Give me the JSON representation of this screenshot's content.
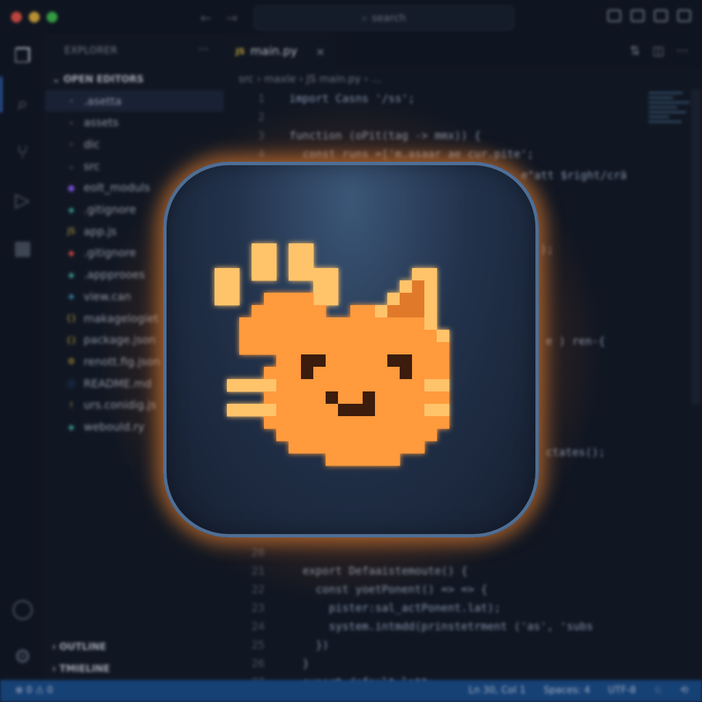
{
  "window": {
    "search_label": "search"
  },
  "activity_bar": {
    "items": [
      "files-icon",
      "search-icon",
      "source-control-icon",
      "run-debug-icon",
      "extensions-icon"
    ],
    "bottom": [
      "account-icon",
      "settings-gear-icon"
    ]
  },
  "explorer": {
    "title": "EXPLORER",
    "more": "···",
    "open_editors_label": "OPEN EDITORS",
    "files": [
      {
        "name": ".asetta",
        "icon": "›",
        "color": "#8a94a6"
      },
      {
        "name": "assets",
        "icon": "›",
        "color": "#8a94a6"
      },
      {
        "name": "dic",
        "icon": "›",
        "color": "#8a94a6"
      },
      {
        "name": "src",
        "icon": "⌄",
        "color": "#8a94a6"
      },
      {
        "name": "eolt_moduls",
        "icon": "●",
        "color": "#8b5cf6"
      },
      {
        "name": ".gitignore",
        "icon": "◆",
        "color": "#3fa7a0"
      },
      {
        "name": "app.js",
        "icon": "JS",
        "color": "#e8c547"
      },
      {
        "name": ".gitignore",
        "icon": "◆",
        "color": "#e5534b"
      },
      {
        "name": ".appprooes",
        "icon": "◆",
        "color": "#3fa7a0"
      },
      {
        "name": "view.can",
        "icon": "◆",
        "color": "#3b82a6"
      },
      {
        "name": "makagelogiet",
        "icon": "{}",
        "color": "#e8c547"
      },
      {
        "name": "package.json",
        "icon": "{}",
        "color": "#e8c547"
      },
      {
        "name": "renott.fig.json",
        "icon": "⚙",
        "color": "#e8c547"
      },
      {
        "name": "README.md",
        "icon": "ⓘ",
        "color": "#3b82f6"
      },
      {
        "name": "urs.conidig.js",
        "icon": "!",
        "color": "#e8c547"
      },
      {
        "name": "webould.ry",
        "icon": "◆",
        "color": "#3fa7a0"
      }
    ],
    "outline_label": "OUTLINE",
    "timeline_label": "TMIELINE"
  },
  "editor": {
    "tab_icon": "JS",
    "tab_label": "main.py",
    "tab_close": "×",
    "breadcrumb": "src › maxle › JS main.py › ...",
    "code_top": [
      {
        "ln": "1",
        "text": "import Casns '/ss';"
      },
      {
        "ln": "2",
        "text": ""
      },
      {
        "ln": "3",
        "text": "function (oPit(tag -> mmx)) {"
      },
      {
        "ln": "4",
        "text": "  const runs =['m.asaar ae cur.pite';"
      }
    ],
    "code_fragments": [
      {
        "text": "e\"att $right/crä"
      },
      {
        "text": ");"
      },
      {
        "text": "e ) ren-{"
      },
      {
        "text": "ctates();"
      }
    ],
    "code_bottom": [
      {
        "ln": "20",
        "text": ""
      },
      {
        "ln": "21",
        "text": "  export Defaaistemoute() {"
      },
      {
        "ln": "22",
        "text": "    const yoetPonent() => => {"
      },
      {
        "ln": "23",
        "text": "      pister:sal_actPonent.lat);"
      },
      {
        "ln": "24",
        "text": "      system.intmdd(prinstetrment ('as', 'subs"
      },
      {
        "ln": "25",
        "text": "    })"
      },
      {
        "ln": "26",
        "text": "  }"
      },
      {
        "ln": "27",
        "text": "  export default.latt;"
      }
    ]
  },
  "status": {
    "left": "⊗ 0 ⚠ 0",
    "position": "Ln 30, Col 1",
    "spaces": "Spaces: 4",
    "encoding": "UTF-8"
  },
  "overlay": {
    "icon_name": "pixel-cat-paw-app-icon",
    "colors": {
      "fur": "#ff9a3c",
      "highlight": "#ffc36a",
      "outline": "#c8551e",
      "eye": "#3a1e10",
      "ear_inner": "#e07a2c"
    }
  }
}
